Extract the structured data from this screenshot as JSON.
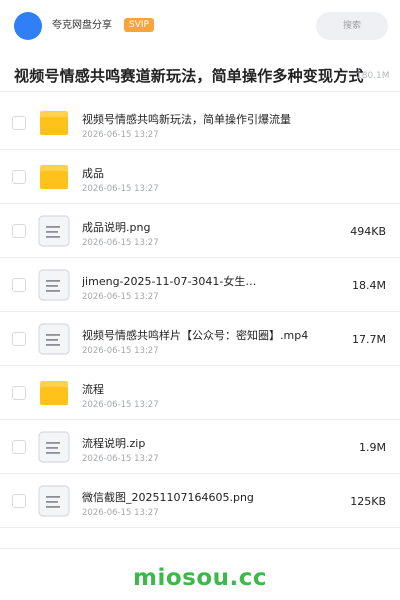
{
  "header": {
    "share_name": "夸克网盘分享",
    "badge": "SVIP",
    "search_label": "搜索"
  },
  "folder": {
    "title": "视频号情感共鸣赛道新玩法，简单操作多种变现方式",
    "total_size": "180.1M"
  },
  "files": [
    {
      "name": "视频号情感共鸣新玩法，简单操作引爆流量",
      "date": "2026-06-15 13:27",
      "size": "",
      "icon": "folder-icon"
    },
    {
      "name": "成品",
      "date": "2026-06-15 13:27",
      "size": "",
      "icon": "folder-icon"
    },
    {
      "name": "成品说明.png",
      "date": "2026-06-15 13:27",
      "size": "494KB",
      "icon": "file-icon"
    },
    {
      "name": "jimeng-2025-11-07-3041-女生…",
      "date": "2026-06-15 13:27",
      "size": "18.4M",
      "icon": "file-icon"
    },
    {
      "name": "视频号情感共鸣样片【公众号：密知圈】.mp4",
      "date": "2026-06-15 13:27",
      "size": "17.7M",
      "icon": "file-icon"
    },
    {
      "name": "流程",
      "date": "2026-06-15 13:27",
      "size": "",
      "icon": "folder-icon"
    },
    {
      "name": "流程说明.zip",
      "date": "2026-06-15 13:27",
      "size": "1.9M",
      "icon": "file-icon"
    },
    {
      "name": "微信截图_20251107164605.png",
      "date": "2026-06-15 13:27",
      "size": "125KB",
      "icon": "file-icon"
    }
  ],
  "watermark": "miosou.cc",
  "colors": {
    "accent_blue": "#2f80f6",
    "svip_orange": "#f7a53b",
    "folder_yellow": "#ffc21a",
    "watermark_green": "#3cb94a"
  }
}
